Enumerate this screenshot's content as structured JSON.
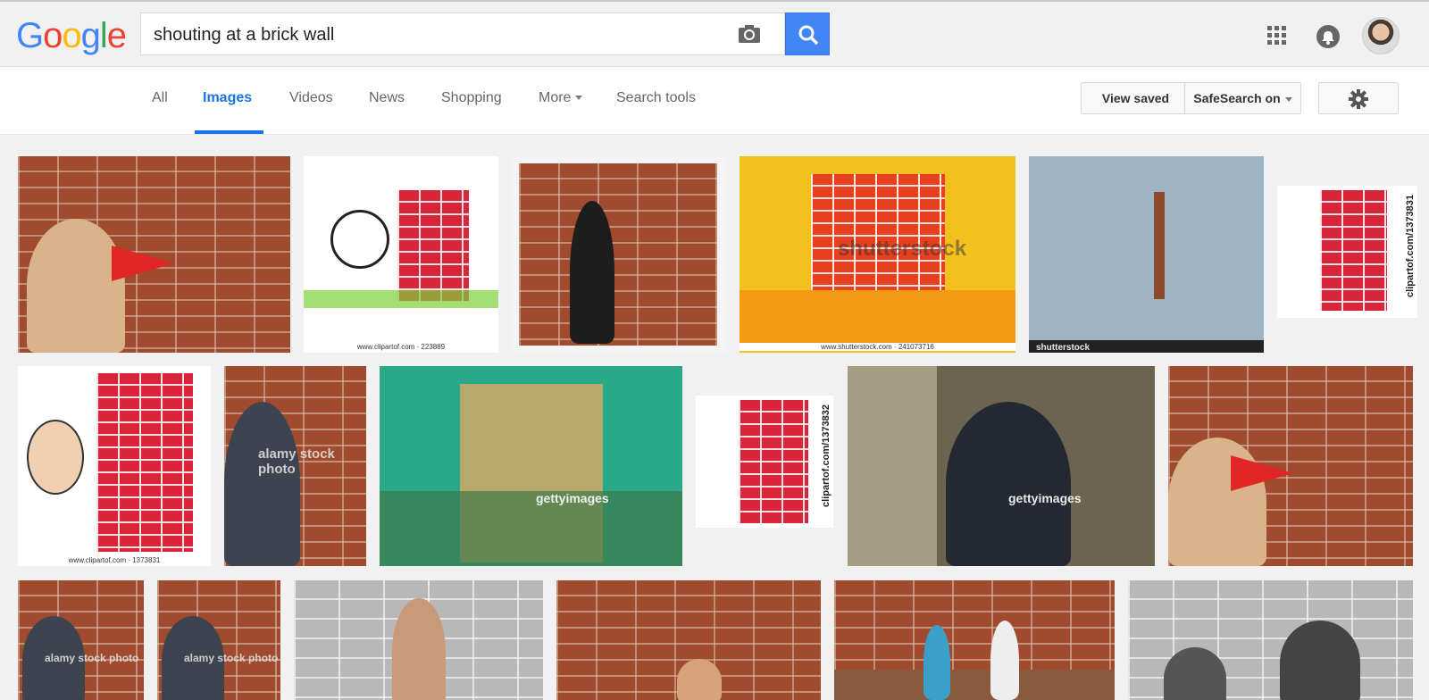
{
  "logo": {
    "letters": [
      "G",
      "o",
      "o",
      "g",
      "l",
      "e"
    ],
    "colors": [
      "#4285f4",
      "#ea4335",
      "#fbbc05",
      "#4285f4",
      "#34a853",
      "#ea4335"
    ]
  },
  "search": {
    "query": "shouting at a brick wall"
  },
  "icons": {
    "camera": "camera-icon",
    "search": "search-icon",
    "apps": "apps-grid-icon",
    "notifications": "bell-icon",
    "settings": "gear-icon"
  },
  "nav": {
    "tabs": [
      "All",
      "Images",
      "Videos",
      "News",
      "Shopping",
      "More",
      "Search tools"
    ],
    "active": "Images",
    "view_saved": "View saved",
    "safesearch": "SafeSearch on"
  },
  "accent": "#1a73e8",
  "images": {
    "r1": {
      "i2_caption": "www.clipartof.com · 223889",
      "i4_caption": "www.shutterstock.com · 241073716",
      "i4_watermark": "shutterstock",
      "i5_watermark": "shutterstock",
      "i6_side": "clipartof.com/1373831"
    },
    "r2": {
      "i1_caption": "www.clipartof.com · 1373831",
      "i2_watermark": "alamy stock photo",
      "i3_watermark": "gettyimages",
      "i4_side": "clipartof.com/1373832",
      "i5_watermark": "gettyimages"
    },
    "r3": {
      "i1_watermark": "alamy stock photo",
      "i2_watermark": "alamy stock photo"
    }
  }
}
